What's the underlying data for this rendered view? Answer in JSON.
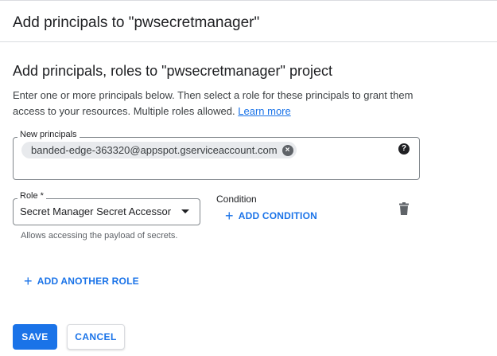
{
  "header": {
    "title": "Add principals to \"pwsecretmanager\""
  },
  "section": {
    "title": "Add principals, roles to \"pwsecretmanager\" project",
    "description": "Enter one or more principals below. Then select a role for these principals to grant them access to your resources. Multiple roles allowed.",
    "learn_more": "Learn more"
  },
  "principals": {
    "label": "New principals",
    "chips": [
      "banded-edge-363320@appspot.gserviceaccount.com"
    ],
    "help_icon": "help-circle-icon"
  },
  "role": {
    "label": "Role *",
    "value": "Secret Manager Secret Accessor",
    "hint": "Allows accessing the payload of secrets."
  },
  "condition": {
    "label": "Condition",
    "add_label": "ADD CONDITION"
  },
  "add_role": {
    "label": "ADD ANOTHER ROLE"
  },
  "actions": {
    "save_label": "SAVE",
    "cancel_label": "CANCEL"
  },
  "colors": {
    "accent": "#1a73e8",
    "text": "#202124",
    "muted": "#5f6368",
    "border": "#80868b"
  }
}
